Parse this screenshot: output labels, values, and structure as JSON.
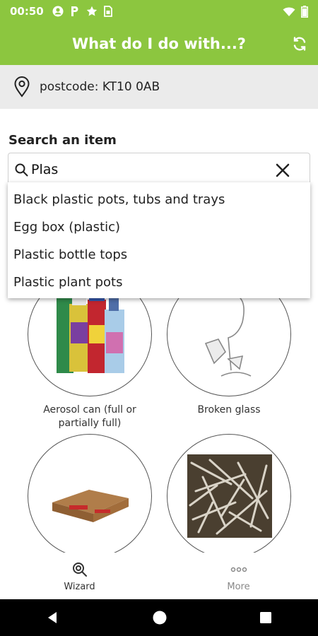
{
  "status_bar": {
    "time": "00:50",
    "icons": [
      "account-circle-icon",
      "parking-icon",
      "star-icon",
      "sim-card-icon"
    ],
    "right_icons": [
      "wifi-icon",
      "battery-icon"
    ]
  },
  "app_bar": {
    "title": "What do I do with...?",
    "refresh_icon": "refresh-icon"
  },
  "location": {
    "postcode_text": "postcode: KT10 0AB",
    "icon": "location-pin-icon"
  },
  "search": {
    "label": "Search an item",
    "value": "Plas",
    "suggestions": [
      "Black plastic pots, tubs and trays",
      "Egg box (plastic)",
      "Plastic bottle tops",
      "Plastic plant pots"
    ]
  },
  "items": [
    {
      "label": "Aerosol can (full or partially full)",
      "image": "aerosol-cans"
    },
    {
      "label": "Broken glass",
      "image": "broken-wine-glass"
    },
    {
      "label": "",
      "image": "flattened-cardboard"
    },
    {
      "label": "",
      "image": "wood-shavings"
    }
  ],
  "bottom_nav": {
    "wizard_label": "Wizard",
    "more_label": "More"
  },
  "colors": {
    "brand_green": "#8cc63f",
    "postcode_bg": "#ebebeb"
  }
}
